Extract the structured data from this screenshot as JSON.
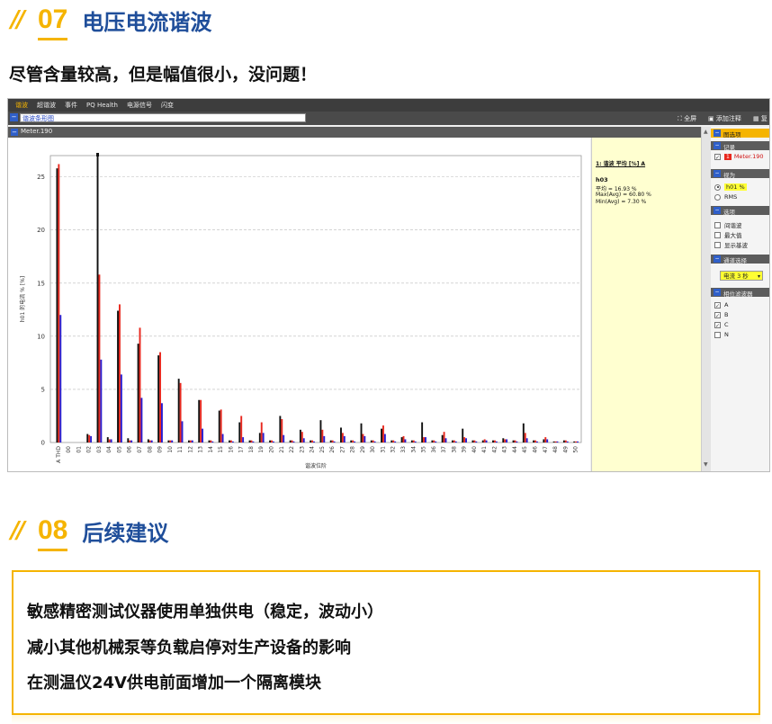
{
  "section1": {
    "slash": "//",
    "number": "07",
    "title": "电压电流谐波"
  },
  "subtitle": "尽管含量较高，但是幅值很小，没问题！",
  "app": {
    "menu": [
      "谐波",
      "超谐波",
      "事件",
      "PQ Health",
      "电源信号",
      "闪变"
    ],
    "active_menu": "谐波",
    "view_field": "谐波条形图",
    "toolbar_right": {
      "fullscreen": "全屏",
      "annotate": "添加注释",
      "copy": "复"
    },
    "chart_panel_title": "Meter.190",
    "chart_data": {
      "type": "bar",
      "title": "",
      "xlabel": "谐波位阶",
      "ylabel": "h01 的电流 % [%]",
      "ylim": [
        0,
        27
      ],
      "yticks": [
        0,
        5,
        10,
        15,
        20,
        25
      ],
      "grid": true,
      "categories": [
        "THD",
        "00",
        "01",
        "02",
        "03",
        "04",
        "05",
        "06",
        "07",
        "08",
        "09",
        "10",
        "11",
        "12",
        "13",
        "14",
        "15",
        "16",
        "17",
        "18",
        "19",
        "20",
        "21",
        "22",
        "23",
        "24",
        "25",
        "26",
        "27",
        "28",
        "29",
        "30",
        "31",
        "32",
        "33",
        "34",
        "35",
        "36",
        "37",
        "38",
        "39",
        "40",
        "41",
        "42",
        "43",
        "44",
        "45",
        "46",
        "47",
        "48",
        "49",
        "50"
      ],
      "x_prefix": "A",
      "series": [
        {
          "name": "A",
          "color": "#111111",
          "values": [
            25.8,
            0,
            0,
            0.8,
            27.0,
            0.5,
            12.4,
            0.4,
            9.3,
            0.3,
            8.2,
            0.2,
            6.0,
            0.2,
            4.0,
            0.2,
            3.0,
            0.2,
            1.9,
            0.2,
            0.9,
            0.2,
            2.5,
            0.2,
            1.2,
            0.2,
            2.1,
            0.2,
            1.4,
            0.2,
            1.8,
            0.2,
            1.3,
            0.2,
            0.5,
            0.2,
            1.9,
            0.2,
            0.7,
            0.2,
            1.3,
            0.2,
            0.2,
            0.2,
            0.4,
            0.2,
            1.8,
            0.2,
            0.3,
            0.1,
            0.2,
            0.1
          ]
        },
        {
          "name": "B",
          "color": "#e8281e",
          "values": [
            26.2,
            0,
            0,
            0.7,
            15.8,
            0.3,
            13.0,
            0.2,
            10.8,
            0.2,
            8.5,
            0.2,
            5.6,
            0.2,
            4.0,
            0.2,
            3.1,
            0.2,
            2.5,
            0.2,
            1.9,
            0.2,
            2.2,
            0.2,
            1.0,
            0.2,
            1.2,
            0.2,
            0.9,
            0.2,
            0.8,
            0.2,
            1.6,
            0.2,
            0.6,
            0.2,
            0.5,
            0.2,
            1.0,
            0.2,
            0.5,
            0.2,
            0.3,
            0.2,
            0.3,
            0.2,
            0.9,
            0.2,
            0.5,
            0.1,
            0.2,
            0.1
          ]
        },
        {
          "name": "C",
          "color": "#2a1fd0",
          "values": [
            12.0,
            0,
            0,
            0.6,
            7.8,
            0.3,
            6.4,
            0.2,
            4.2,
            0.2,
            3.7,
            0.2,
            2.0,
            0.2,
            1.3,
            0.1,
            0.8,
            0.1,
            0.5,
            0.1,
            0.9,
            0.1,
            0.7,
            0.1,
            0.4,
            0.1,
            0.6,
            0.1,
            0.6,
            0.1,
            0.6,
            0.1,
            0.8,
            0.1,
            0.3,
            0.1,
            0.5,
            0.1,
            0.4,
            0.1,
            0.4,
            0.1,
            0.2,
            0.1,
            0.3,
            0.1,
            0.4,
            0.1,
            0.3,
            0.1,
            0.1,
            0.1
          ]
        }
      ]
    },
    "info": {
      "title": "1: 谐波 平均 [%] A",
      "h": "h03",
      "lines": [
        "平均 = 16.93 %",
        "Max(Avg) = 60.80 %",
        "Min(Avg) = 7.30 %"
      ]
    },
    "panel": {
      "header": "图选项",
      "record_header": "记录",
      "record_item": "Meter.190",
      "record_badge": "1",
      "as_header": "视为",
      "radio1": "h01 %",
      "radio2": "RMS",
      "options_header": "选项",
      "opt1": "间谐波",
      "opt2": "最大值",
      "opt3": "显示基波",
      "channel_header": "通道选择",
      "channel_value": "电流 3 秒",
      "phase_header": "相位滤波器",
      "phases": [
        "A",
        "B",
        "C",
        "N"
      ],
      "phase_checked": [
        true,
        true,
        true,
        false
      ]
    }
  },
  "section2": {
    "slash": "//",
    "number": "08",
    "title": "后续建议"
  },
  "suggestions": [
    "敏感精密测试仪器使用单独供电（稳定，波动小）",
    "减小其他机械泵等负载启停对生产设备的影响",
    "在测温仪24V供电前面增加一个隔离模块"
  ],
  "colors": {
    "accent": "#f5b400",
    "title_blue": "#1f4e9a",
    "info_bg": "#ffffd0"
  }
}
